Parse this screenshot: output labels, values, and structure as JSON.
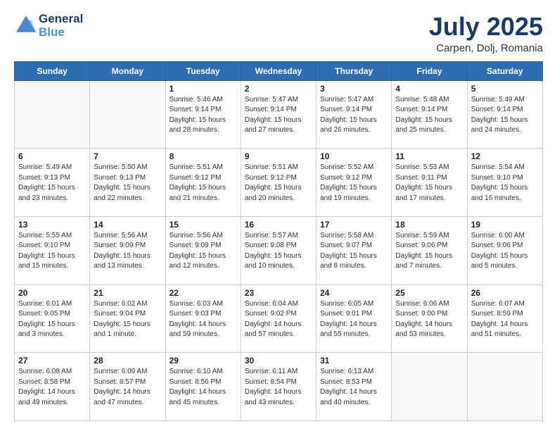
{
  "header": {
    "logo_line1": "General",
    "logo_line2": "Blue",
    "title": "July 2025",
    "subtitle": "Carpen, Dolj, Romania"
  },
  "weekdays": [
    "Sunday",
    "Monday",
    "Tuesday",
    "Wednesday",
    "Thursday",
    "Friday",
    "Saturday"
  ],
  "weeks": [
    [
      {
        "day": "",
        "info": ""
      },
      {
        "day": "",
        "info": ""
      },
      {
        "day": "1",
        "info": "Sunrise: 5:46 AM\nSunset: 9:14 PM\nDaylight: 15 hours\nand 28 minutes."
      },
      {
        "day": "2",
        "info": "Sunrise: 5:47 AM\nSunset: 9:14 PM\nDaylight: 15 hours\nand 27 minutes."
      },
      {
        "day": "3",
        "info": "Sunrise: 5:47 AM\nSunset: 9:14 PM\nDaylight: 15 hours\nand 26 minutes."
      },
      {
        "day": "4",
        "info": "Sunrise: 5:48 AM\nSunset: 9:14 PM\nDaylight: 15 hours\nand 25 minutes."
      },
      {
        "day": "5",
        "info": "Sunrise: 5:49 AM\nSunset: 9:14 PM\nDaylight: 15 hours\nand 24 minutes."
      }
    ],
    [
      {
        "day": "6",
        "info": "Sunrise: 5:49 AM\nSunset: 9:13 PM\nDaylight: 15 hours\nand 23 minutes."
      },
      {
        "day": "7",
        "info": "Sunrise: 5:50 AM\nSunset: 9:13 PM\nDaylight: 15 hours\nand 22 minutes."
      },
      {
        "day": "8",
        "info": "Sunrise: 5:51 AM\nSunset: 9:12 PM\nDaylight: 15 hours\nand 21 minutes."
      },
      {
        "day": "9",
        "info": "Sunrise: 5:51 AM\nSunset: 9:12 PM\nDaylight: 15 hours\nand 20 minutes."
      },
      {
        "day": "10",
        "info": "Sunrise: 5:52 AM\nSunset: 9:12 PM\nDaylight: 15 hours\nand 19 minutes."
      },
      {
        "day": "11",
        "info": "Sunrise: 5:53 AM\nSunset: 9:11 PM\nDaylight: 15 hours\nand 17 minutes."
      },
      {
        "day": "12",
        "info": "Sunrise: 5:54 AM\nSunset: 9:10 PM\nDaylight: 15 hours\nand 16 minutes."
      }
    ],
    [
      {
        "day": "13",
        "info": "Sunrise: 5:55 AM\nSunset: 9:10 PM\nDaylight: 15 hours\nand 15 minutes."
      },
      {
        "day": "14",
        "info": "Sunrise: 5:56 AM\nSunset: 9:09 PM\nDaylight: 15 hours\nand 13 minutes."
      },
      {
        "day": "15",
        "info": "Sunrise: 5:56 AM\nSunset: 9:09 PM\nDaylight: 15 hours\nand 12 minutes."
      },
      {
        "day": "16",
        "info": "Sunrise: 5:57 AM\nSunset: 9:08 PM\nDaylight: 15 hours\nand 10 minutes."
      },
      {
        "day": "17",
        "info": "Sunrise: 5:58 AM\nSunset: 9:07 PM\nDaylight: 15 hours\nand 8 minutes."
      },
      {
        "day": "18",
        "info": "Sunrise: 5:59 AM\nSunset: 9:06 PM\nDaylight: 15 hours\nand 7 minutes."
      },
      {
        "day": "19",
        "info": "Sunrise: 6:00 AM\nSunset: 9:06 PM\nDaylight: 15 hours\nand 5 minutes."
      }
    ],
    [
      {
        "day": "20",
        "info": "Sunrise: 6:01 AM\nSunset: 9:05 PM\nDaylight: 15 hours\nand 3 minutes."
      },
      {
        "day": "21",
        "info": "Sunrise: 6:02 AM\nSunset: 9:04 PM\nDaylight: 15 hours\nand 1 minute."
      },
      {
        "day": "22",
        "info": "Sunrise: 6:03 AM\nSunset: 9:03 PM\nDaylight: 14 hours\nand 59 minutes."
      },
      {
        "day": "23",
        "info": "Sunrise: 6:04 AM\nSunset: 9:02 PM\nDaylight: 14 hours\nand 57 minutes."
      },
      {
        "day": "24",
        "info": "Sunrise: 6:05 AM\nSunset: 9:01 PM\nDaylight: 14 hours\nand 55 minutes."
      },
      {
        "day": "25",
        "info": "Sunrise: 6:06 AM\nSunset: 9:00 PM\nDaylight: 14 hours\nand 53 minutes."
      },
      {
        "day": "26",
        "info": "Sunrise: 6:07 AM\nSunset: 8:59 PM\nDaylight: 14 hours\nand 51 minutes."
      }
    ],
    [
      {
        "day": "27",
        "info": "Sunrise: 6:08 AM\nSunset: 8:58 PM\nDaylight: 14 hours\nand 49 minutes."
      },
      {
        "day": "28",
        "info": "Sunrise: 6:09 AM\nSunset: 8:57 PM\nDaylight: 14 hours\nand 47 minutes."
      },
      {
        "day": "29",
        "info": "Sunrise: 6:10 AM\nSunset: 8:56 PM\nDaylight: 14 hours\nand 45 minutes."
      },
      {
        "day": "30",
        "info": "Sunrise: 6:11 AM\nSunset: 8:54 PM\nDaylight: 14 hours\nand 43 minutes."
      },
      {
        "day": "31",
        "info": "Sunrise: 6:13 AM\nSunset: 8:53 PM\nDaylight: 14 hours\nand 40 minutes."
      },
      {
        "day": "",
        "info": ""
      },
      {
        "day": "",
        "info": ""
      }
    ]
  ]
}
